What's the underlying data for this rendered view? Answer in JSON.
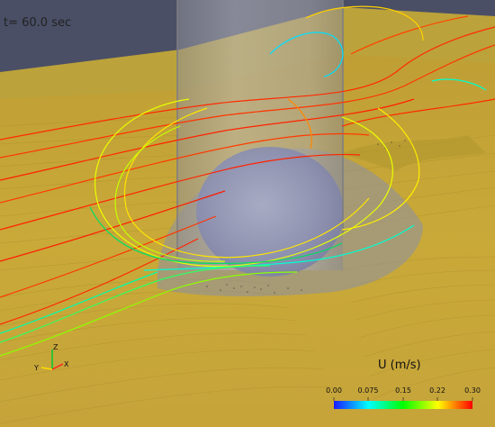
{
  "time_label": "t= 60.0 sec",
  "colorbar": {
    "title": "U (m/s)",
    "ticks": [
      "0.00",
      "0.075",
      "0.15",
      "0.22",
      "0.30"
    ],
    "colors": [
      "#1a1aff",
      "#00ffff",
      "#00ff00",
      "#ffff00",
      "#ff0000"
    ]
  },
  "axes_triad": {
    "z": "Z",
    "y": "Y",
    "x": "X"
  },
  "colors": {
    "background": "#4a4f66",
    "sediment": "#c9a637",
    "pier": "#b8b8c0",
    "scour_hole": "#8f95b8"
  }
}
